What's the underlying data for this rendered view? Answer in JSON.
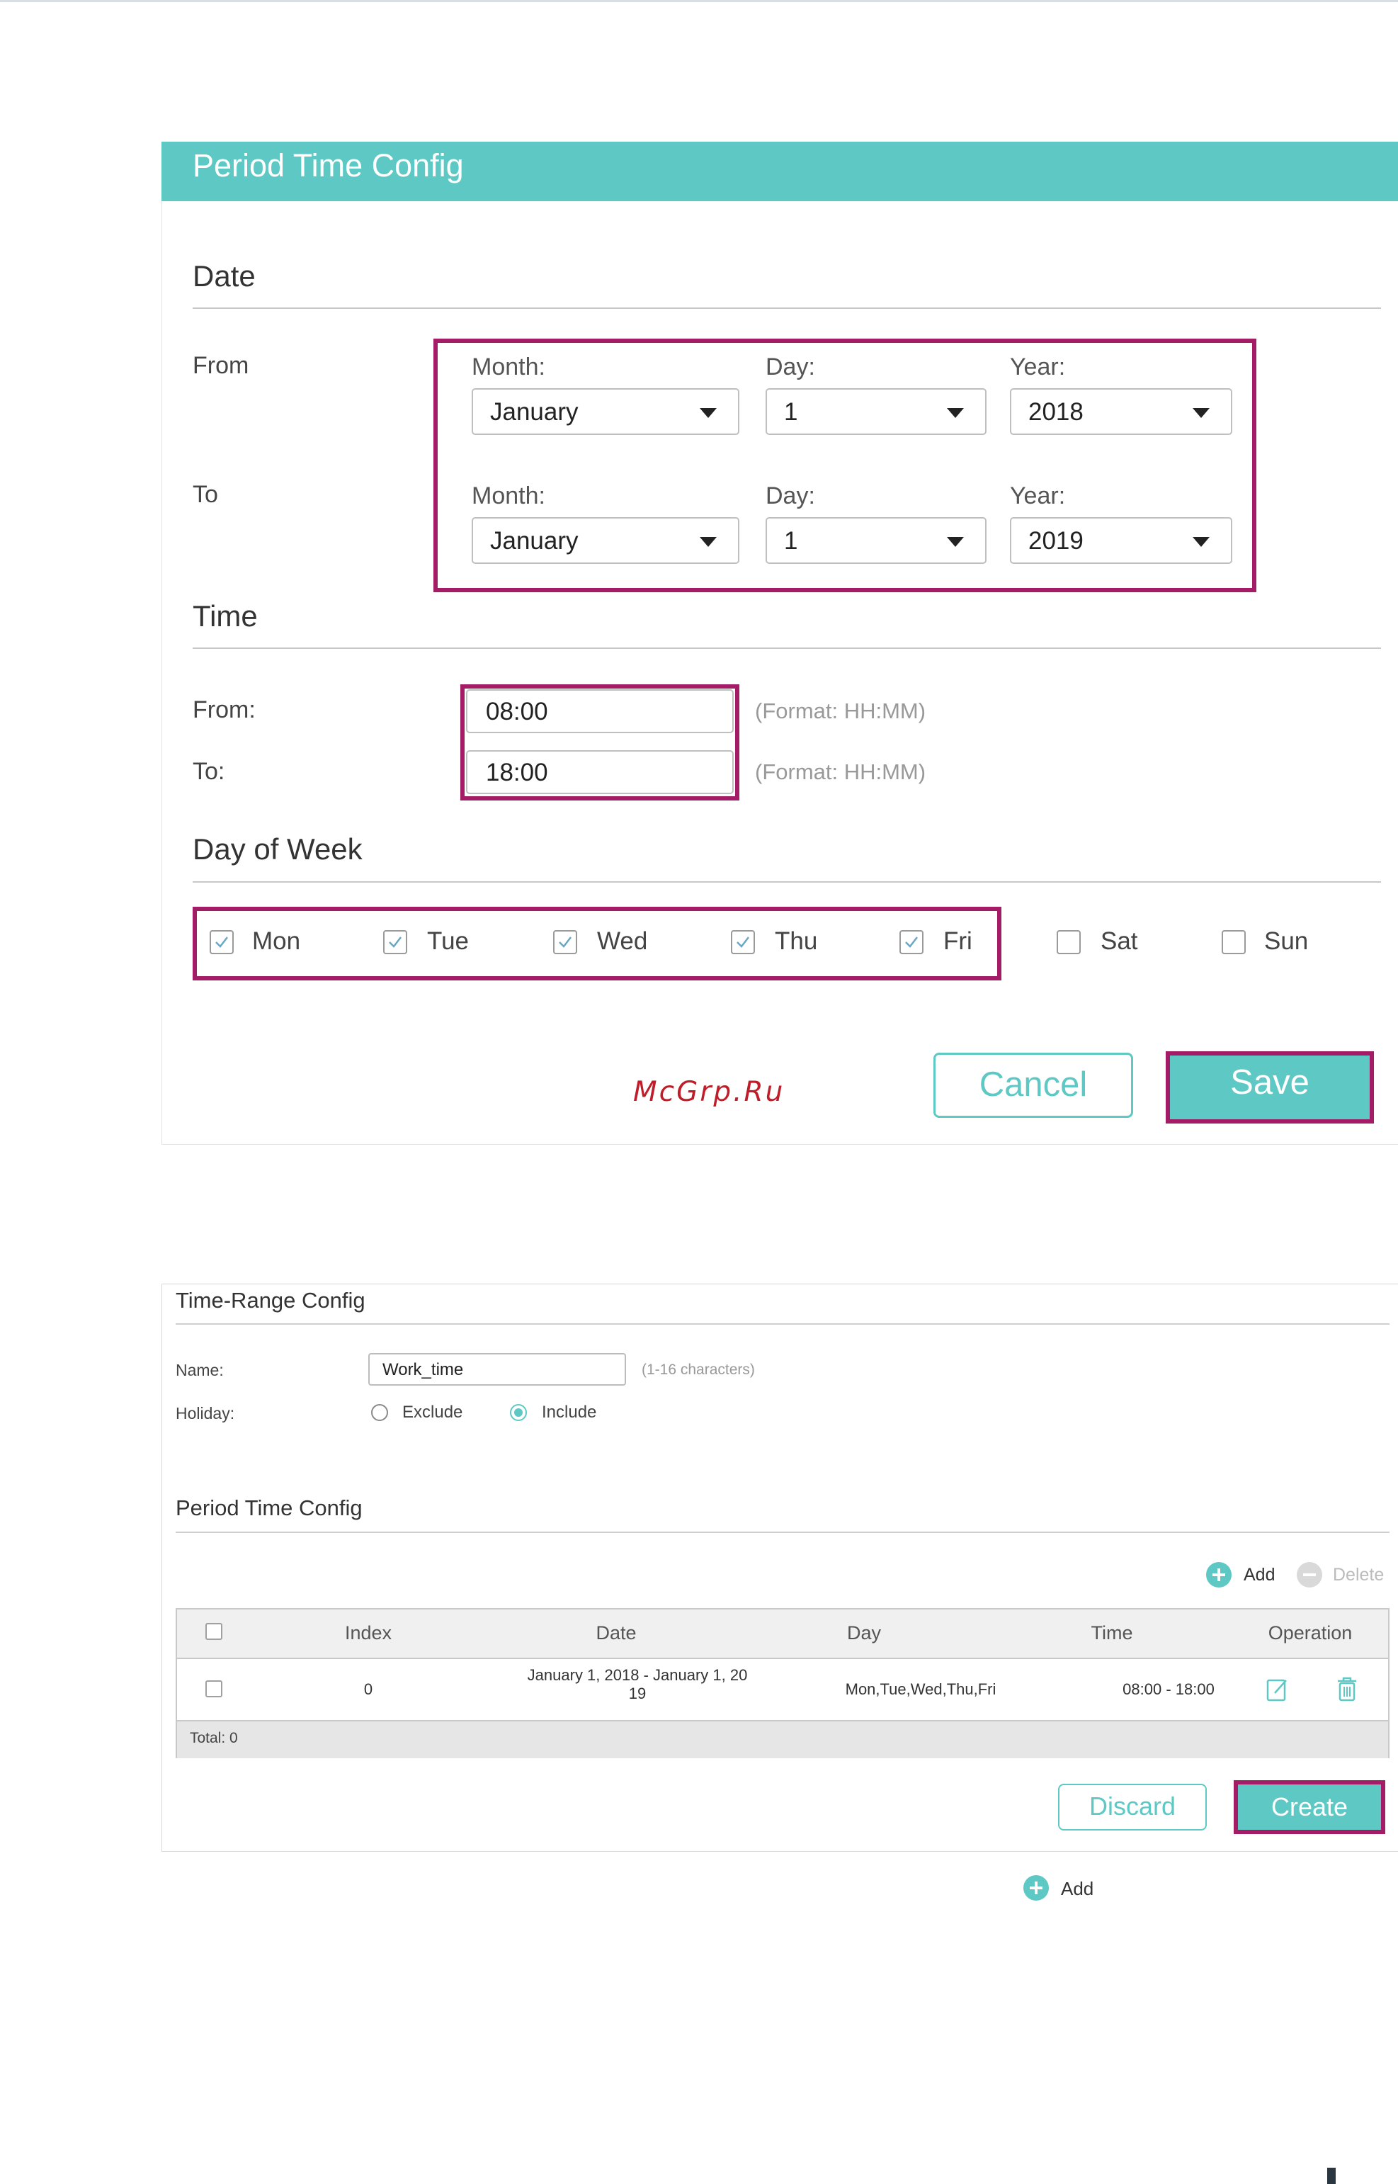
{
  "period_config": {
    "title": "Period Time Config",
    "date_section": {
      "title": "Date",
      "from_label": "From",
      "to_label": "To",
      "month_label": "Month:",
      "day_label": "Day:",
      "year_label": "Year:",
      "from": {
        "month": "January",
        "day": "1",
        "year": "2018"
      },
      "to": {
        "month": "January",
        "day": "1",
        "year": "2019"
      }
    },
    "time_section": {
      "title": "Time",
      "from_label": "From:",
      "to_label": "To:",
      "from_value": "08:00",
      "to_value": "18:00",
      "format_hint": "(Format: HH:MM)"
    },
    "dow_section": {
      "title": "Day of Week",
      "days": [
        {
          "label": "Mon",
          "checked": true
        },
        {
          "label": "Tue",
          "checked": true
        },
        {
          "label": "Wed",
          "checked": true
        },
        {
          "label": "Thu",
          "checked": true
        },
        {
          "label": "Fri",
          "checked": true
        },
        {
          "label": "Sat",
          "checked": false
        },
        {
          "label": "Sun",
          "checked": false
        }
      ]
    },
    "buttons": {
      "cancel": "Cancel",
      "save": "Save"
    },
    "watermark": "McGrp.Ru"
  },
  "time_range": {
    "title": "Time-Range Config",
    "name_label": "Name:",
    "name_value": "Work_time",
    "name_hint": "(1-16 characters)",
    "holiday_label": "Holiday:",
    "holiday_options": [
      "Exclude",
      "Include"
    ],
    "holiday_selected": "Include",
    "period_title": "Period Time Config",
    "toolbar": {
      "add": "Add",
      "delete": "Delete"
    },
    "table": {
      "columns": [
        "Index",
        "Date",
        "Day",
        "Time",
        "Operation"
      ],
      "rows": [
        {
          "index": "0",
          "date_line1": "January 1, 2018 - January 1, 20",
          "date_line2": "19",
          "day": "Mon,Tue,Wed,Thu,Fri",
          "time": "08:00 - 18:00"
        }
      ],
      "total": "Total: 0"
    },
    "buttons": {
      "discard": "Discard",
      "create": "Create"
    },
    "below_add": "Add"
  },
  "colors": {
    "accent": "#5ec8c4",
    "highlight": "#a51c66",
    "watermark": "#c01d2a"
  }
}
